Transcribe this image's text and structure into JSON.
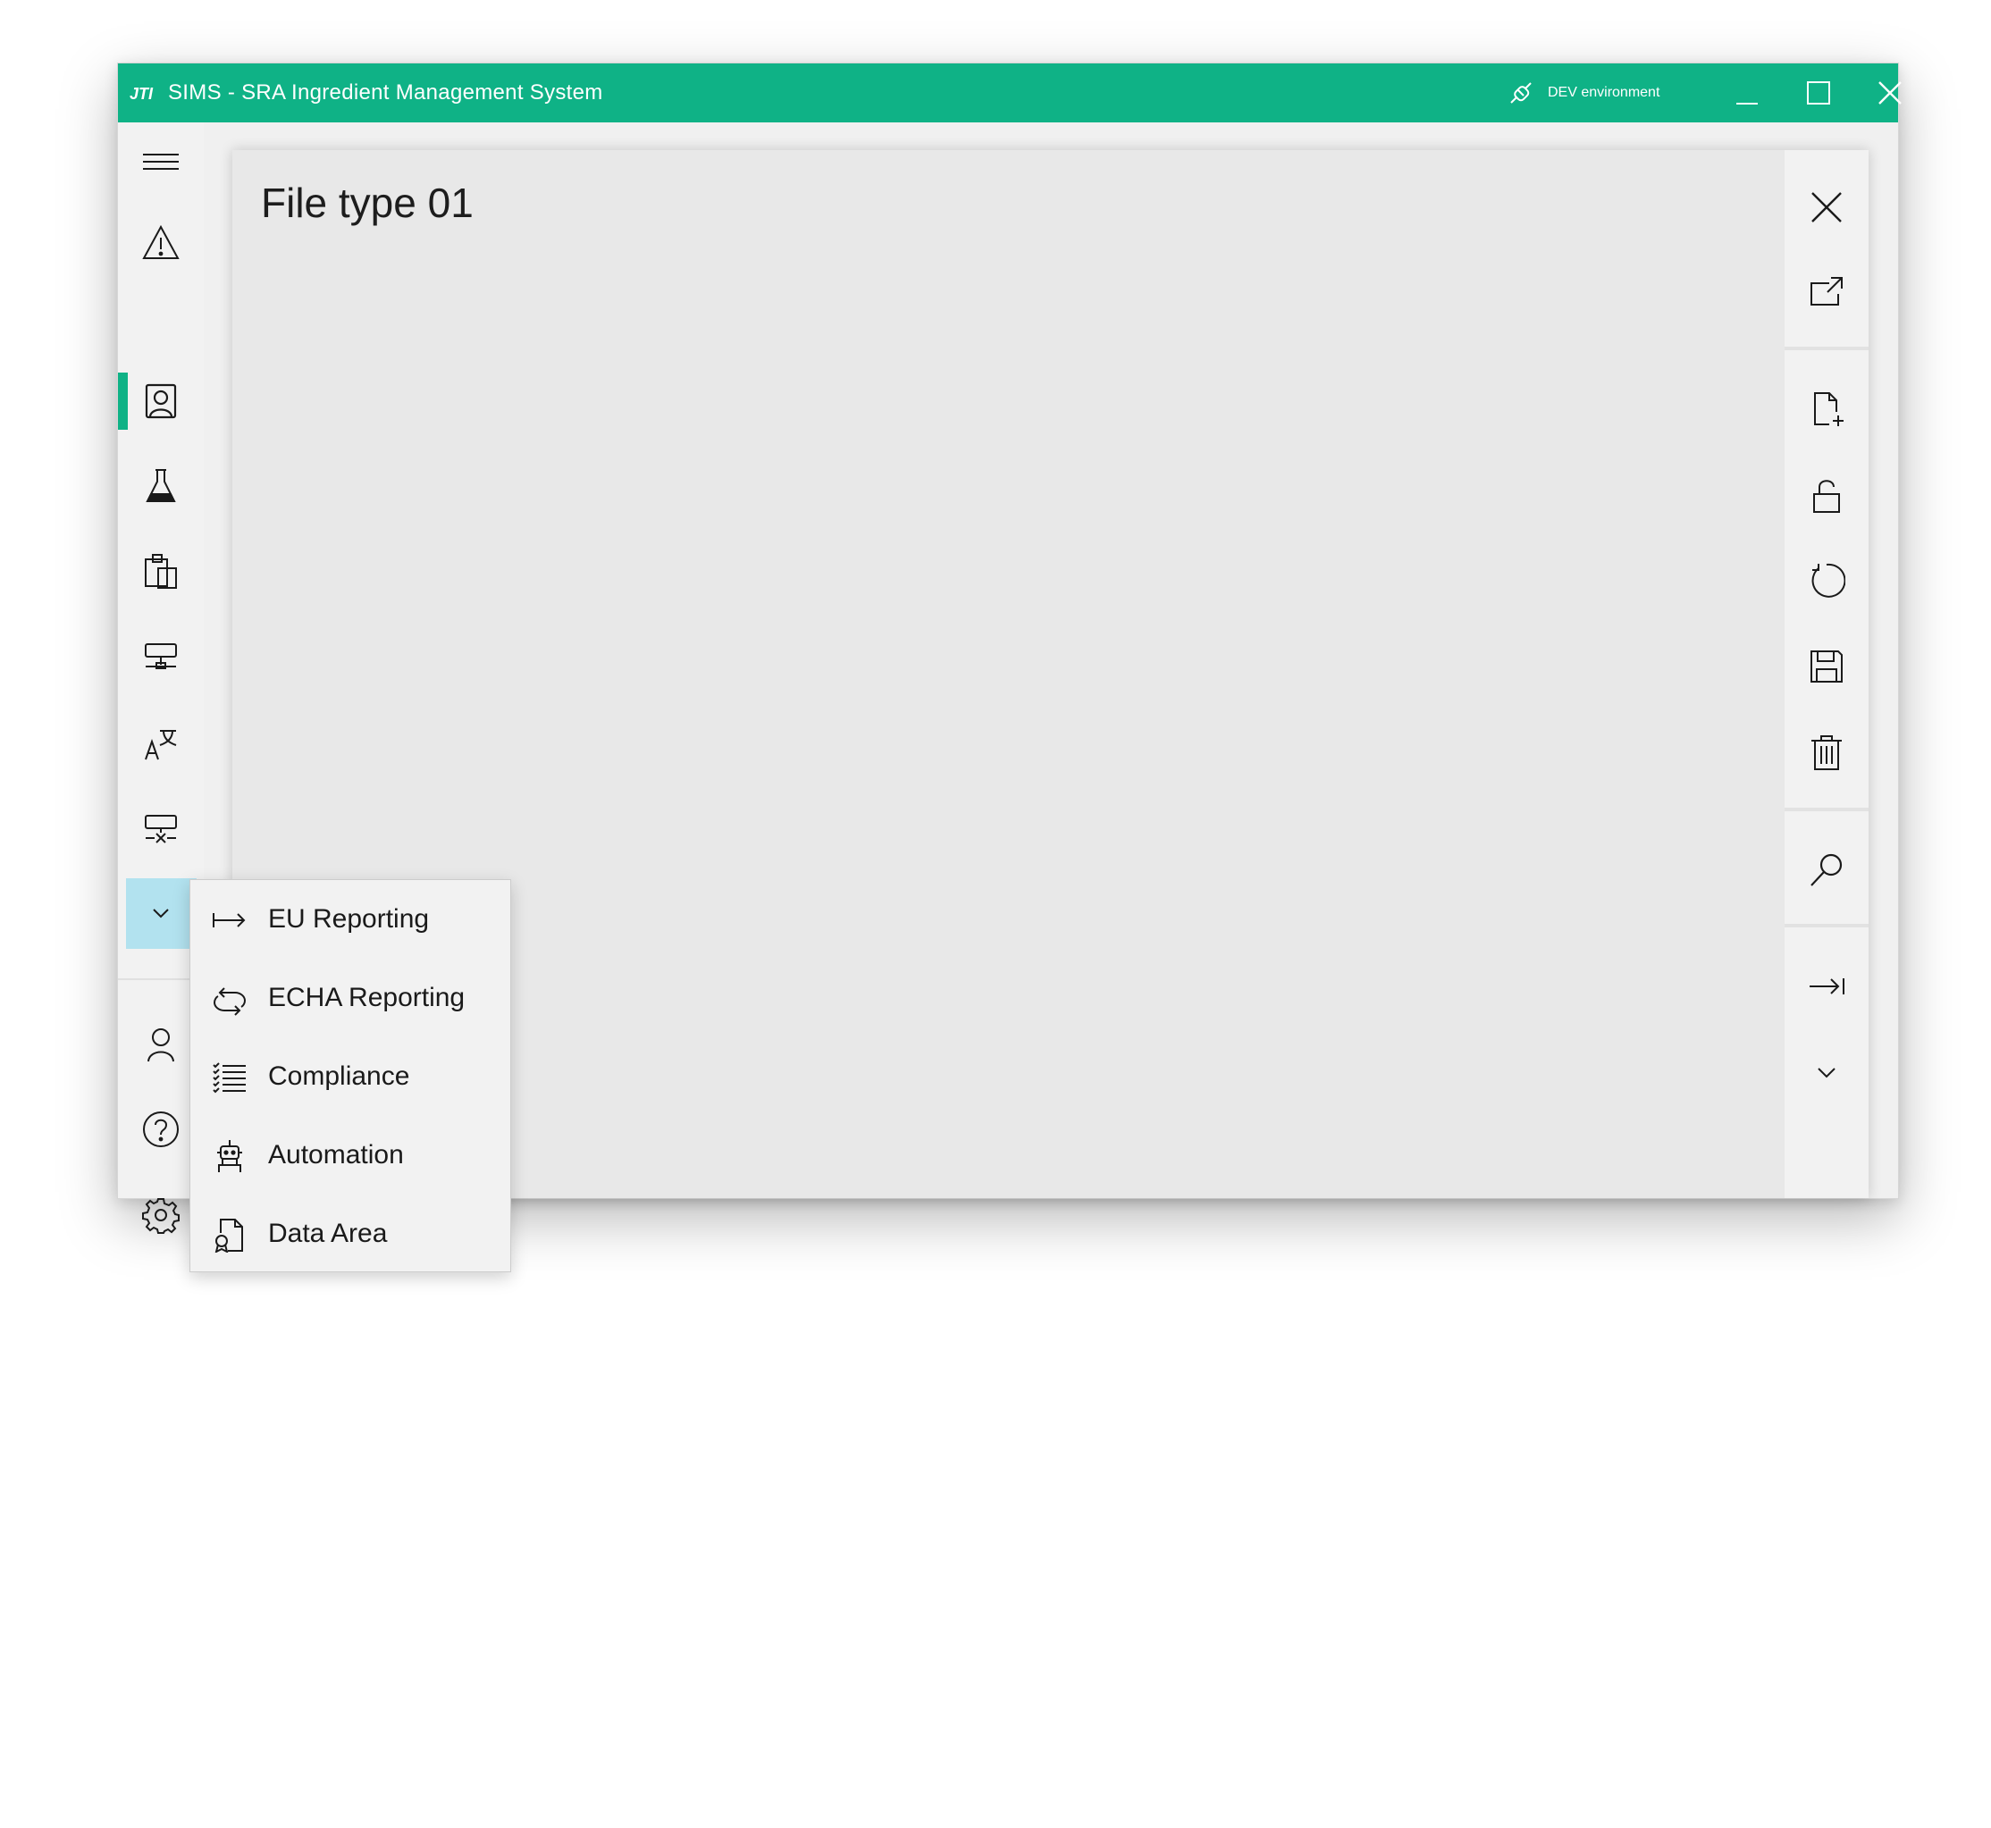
{
  "window": {
    "title": "SIMS - SRA Ingredient Management System",
    "environment": "DEV environment",
    "brand_color": "#0fb286",
    "icons": {
      "logo": "jti-logo",
      "environment": "plug-connection-icon",
      "minimize": "minimize-icon",
      "maximize": "maximize-icon",
      "close": "close-icon"
    }
  },
  "nav": {
    "items": [
      {
        "icon": "hamburger-menu-icon"
      },
      {
        "icon": "warning-icon"
      },
      {
        "icon": "contact-card-icon",
        "active": true
      },
      {
        "icon": "flask-icon"
      },
      {
        "icon": "clipboard-icon"
      },
      {
        "icon": "network-icon"
      },
      {
        "icon": "translate-icon"
      },
      {
        "icon": "network-disconnect-icon"
      },
      {
        "icon": "chevron-down-icon",
        "selected": true
      }
    ],
    "bottom_items": [
      {
        "icon": "user-icon"
      },
      {
        "icon": "help-icon"
      },
      {
        "icon": "settings-icon"
      }
    ]
  },
  "panel": {
    "title": "File type 01"
  },
  "command_bar": {
    "items": [
      "close-icon",
      "open-in-window-icon",
      "new-document-icon",
      "unlock-icon",
      "refresh-icon",
      "save-icon",
      "delete-icon",
      "search-icon",
      "go-to-end-icon",
      "chevron-down-icon"
    ]
  },
  "flyout": {
    "items": [
      {
        "label": "EU Reporting",
        "icon": "arrow-export-icon"
      },
      {
        "label": "ECHA Reporting",
        "icon": "sync-icon"
      },
      {
        "label": "Compliance",
        "icon": "checklist-icon"
      },
      {
        "label": "Automation",
        "icon": "robot-icon"
      },
      {
        "label": "Data Area",
        "icon": "document-badge-icon"
      }
    ]
  }
}
